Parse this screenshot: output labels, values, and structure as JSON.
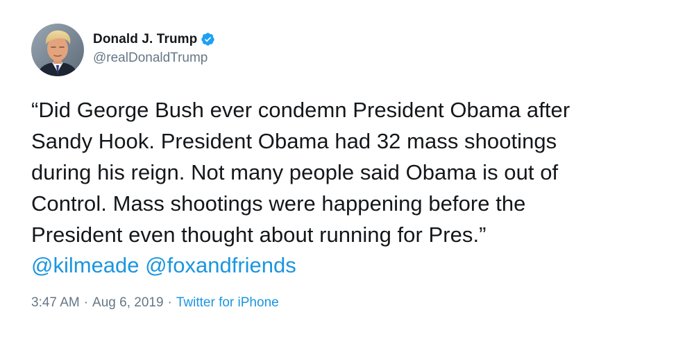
{
  "user": {
    "display_name": "Donald J. Trump",
    "handle": "@realDonaldTrump",
    "verified": true,
    "avatar_icon": "profile-photo-avatar"
  },
  "tweet": {
    "text": "“Did George Bush ever condemn President Obama after\nSandy Hook. President Obama had 32 mass shootings\nduring his reign. Not many people said Obama is out of\nControl. Mass shootings were happening before the\nPresident even thought about running for Pres.”",
    "mentions": [
      "@kilmeade",
      "@foxandfriends"
    ]
  },
  "meta": {
    "time": "3:47 AM",
    "separator": "·",
    "date": "Aug 6, 2019",
    "source": "Twitter for iPhone"
  },
  "colors": {
    "link": "#1b95e0",
    "text": "#14171a",
    "secondary": "#657786",
    "verified": "#1da1f2"
  }
}
